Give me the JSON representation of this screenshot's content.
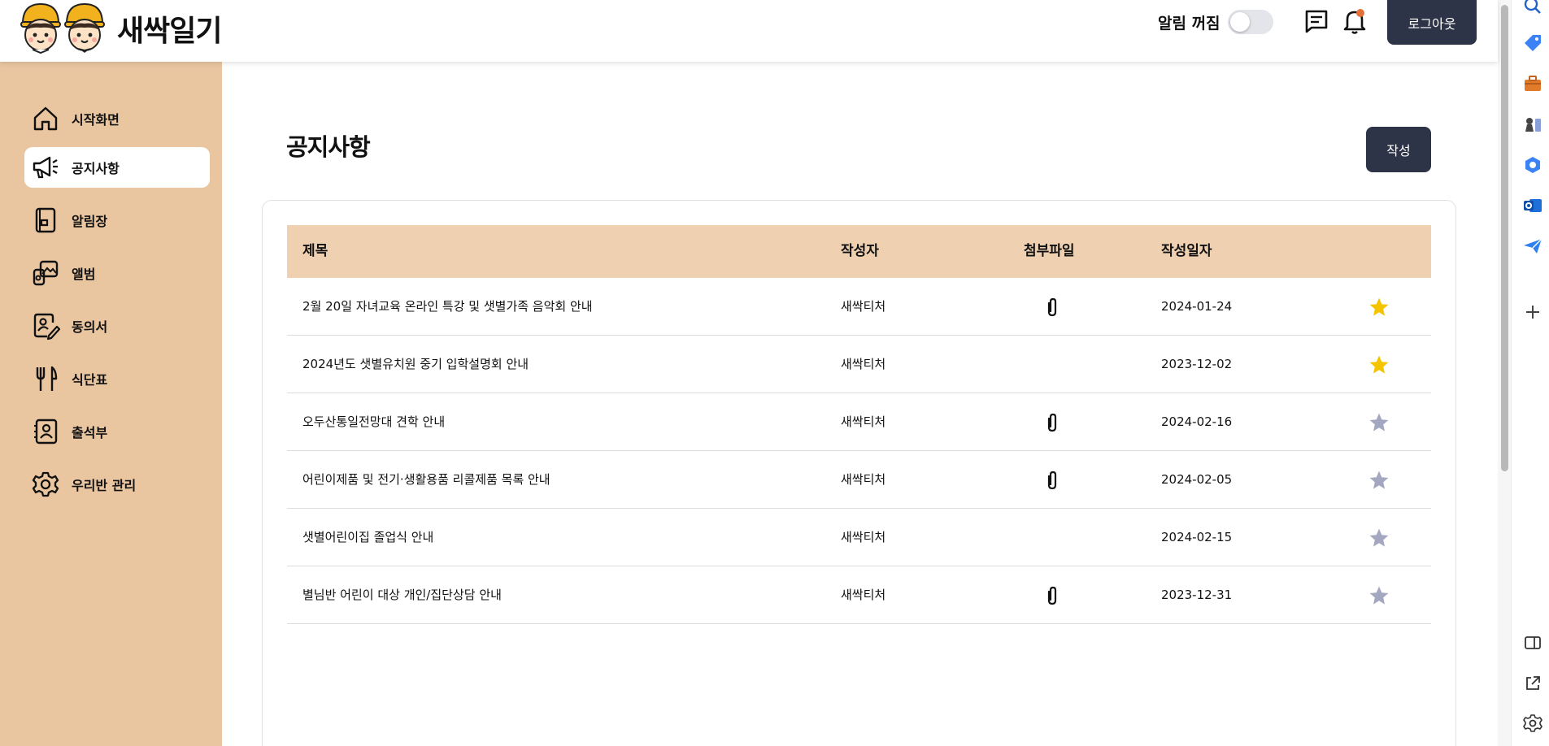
{
  "app": {
    "name": "새싹일기"
  },
  "header": {
    "alarm_label": "알림 꺼짐",
    "alarm_on": false,
    "logout_label": "로그아웃",
    "icons": [
      "chat-icon",
      "bell-icon"
    ]
  },
  "sidebar": {
    "items": [
      {
        "label": "시작화면",
        "icon": "home-icon"
      },
      {
        "label": "공지사항",
        "icon": "megaphone-icon",
        "active": true
      },
      {
        "label": "알림장",
        "icon": "notebook-icon"
      },
      {
        "label": "앨범",
        "icon": "album-icon"
      },
      {
        "label": "동의서",
        "icon": "consent-form-icon"
      },
      {
        "label": "식단표",
        "icon": "fork-knife-icon"
      },
      {
        "label": "출석부",
        "icon": "attendance-icon"
      },
      {
        "label": "우리반 관리",
        "icon": "gear-icon"
      }
    ]
  },
  "main": {
    "title": "공지사항",
    "write_label": "작성",
    "columns": [
      "제목",
      "작성자",
      "첨부파일",
      "작성일자"
    ],
    "rows": [
      {
        "title": "2월 20일 자녀교육 온라인 특강 및 샛별가족 음악회 안내",
        "author": "새싹티처",
        "attachment": true,
        "date": "2024-01-24",
        "starred": true
      },
      {
        "title": "2024년도 샛별유치원 중기 입학설명회 안내",
        "author": "새싹티처",
        "attachment": false,
        "date": "2023-12-02",
        "starred": true
      },
      {
        "title": "오두산통일전망대 견학 안내",
        "author": "새싹티처",
        "attachment": true,
        "date": "2024-02-16",
        "starred": false
      },
      {
        "title": "어린이제품 및 전기·생활용품 리콜제품 목록 안내",
        "author": "새싹티처",
        "attachment": true,
        "date": "2024-02-05",
        "starred": false
      },
      {
        "title": "샛별어린이집 졸업식 안내",
        "author": "새싹티처",
        "attachment": false,
        "date": "2024-02-15",
        "starred": false
      },
      {
        "title": "별님반 어린이 대상 개인/집단상담 안내",
        "author": "새싹티처",
        "attachment": true,
        "date": "2023-12-31",
        "starred": false
      }
    ]
  },
  "colors": {
    "sidebar_bg": "#e9c5a0",
    "table_header_bg": "#efd1b2",
    "button_bg": "#2d3447",
    "star_active": "#f5c400",
    "star_inactive": "#a3a7bf"
  },
  "browser_rail": {
    "icons": [
      "search-icon",
      "tag-icon",
      "briefcase-icon",
      "chess-icon",
      "copilot-icon",
      "outlook-icon",
      "send-icon",
      "add-icon",
      "sidebar-toggle-icon",
      "open-external-icon",
      "settings-icon"
    ]
  }
}
